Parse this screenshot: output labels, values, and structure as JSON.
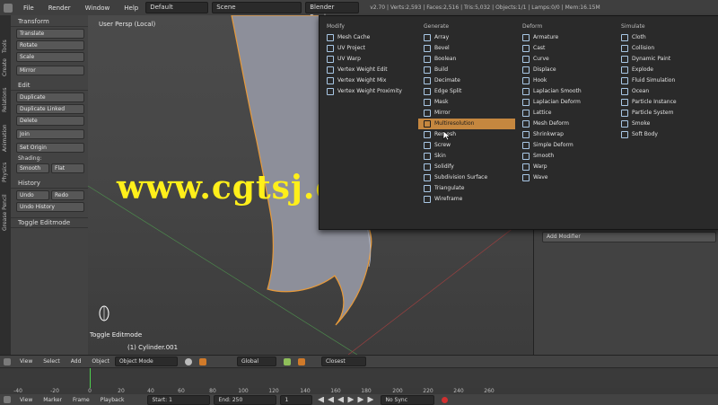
{
  "topbar": {
    "menus": [
      "File",
      "Render",
      "Window",
      "Help"
    ],
    "layout": "Default",
    "scene": "Scene",
    "engine": "Blender Render",
    "info": "v2.70 | Verts:2,593 | Faces:2,516 | Tris:5,032 | Objects:1/1 | Lamps:0/0 | Mem:16.15M"
  },
  "tabs": [
    "Tools",
    "Create",
    "Relations",
    "Animation",
    "Physics",
    "Grease Pencil"
  ],
  "toolshelf": {
    "transform_header": "Transform",
    "transform": [
      "Translate",
      "Rotate",
      "Scale",
      "Mirror"
    ],
    "edit_header": "Edit",
    "edit": [
      "Duplicate",
      "Duplicate Linked",
      "Delete",
      "Join",
      "Set Origin"
    ],
    "shading_label": "Shading:",
    "shading": [
      "Smooth",
      "Flat"
    ],
    "history_header": "History",
    "history": [
      "Undo",
      "Redo",
      "Undo History"
    ],
    "toggle": "Toggle Editmode"
  },
  "viewport": {
    "label": "User Persp (Local)",
    "object": "(1) Cylinder.001",
    "operator": "Toggle Editmode"
  },
  "watermark": "www.cgtsj.com",
  "menu": {
    "columns": [
      {
        "header": "Modify",
        "items": [
          "Mesh Cache",
          "UV Project",
          "UV Warp",
          "Vertex Weight Edit",
          "Vertex Weight Mix",
          "Vertex Weight Proximity"
        ]
      },
      {
        "header": "Generate",
        "items": [
          "Array",
          "Bevel",
          "Boolean",
          "Build",
          "Decimate",
          "Edge Split",
          "Mask",
          "Mirror",
          "Multiresolution",
          "Remesh",
          "Screw",
          "Skin",
          "Solidify",
          "Subdivision Surface",
          "Triangulate",
          "Wireframe"
        ]
      },
      {
        "header": "Deform",
        "items": [
          "Armature",
          "Cast",
          "Curve",
          "Displace",
          "Hook",
          "Laplacian Smooth",
          "Laplacian Deform",
          "Lattice",
          "Mesh Deform",
          "Shrinkwrap",
          "Simple Deform",
          "Smooth",
          "Warp",
          "Wave"
        ]
      },
      {
        "header": "Simulate",
        "items": [
          "Cloth",
          "Collision",
          "Dynamic Paint",
          "Explode",
          "Fluid Simulation",
          "Ocean",
          "Particle Instance",
          "Particle System",
          "Smoke",
          "Soft Body"
        ]
      }
    ],
    "highlighted": "Multiresolution"
  },
  "props": {
    "add_modifier": "Add Modifier"
  },
  "timeline": {
    "header": [
      "View",
      "Select",
      "Add",
      "Object"
    ],
    "mode": "Object Mode",
    "pivot": "Global",
    "snap": "Closest",
    "ruler": [
      "-40",
      "-20",
      "0",
      "20",
      "40",
      "60",
      "80",
      "100",
      "120",
      "140",
      "160",
      "180",
      "200",
      "220",
      "240",
      "260"
    ],
    "footer": [
      "View",
      "Marker",
      "Frame",
      "Playback"
    ],
    "start": "Start: 1",
    "end": "End: 250",
    "current": "1",
    "sync": "No Sync"
  }
}
